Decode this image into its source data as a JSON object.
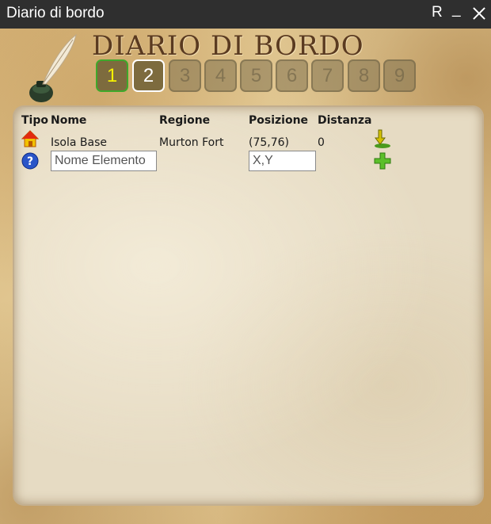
{
  "window": {
    "title": "Diario di bordo",
    "btn_r": "R",
    "btn_min": "_"
  },
  "header": {
    "logo_text": "DIARIO DI BORDO"
  },
  "pages": [
    {
      "label": "1",
      "state": "active"
    },
    {
      "label": "2",
      "state": "current"
    },
    {
      "label": "3",
      "state": "disabled"
    },
    {
      "label": "4",
      "state": "disabled"
    },
    {
      "label": "5",
      "state": "disabled"
    },
    {
      "label": "6",
      "state": "disabled"
    },
    {
      "label": "7",
      "state": "disabled"
    },
    {
      "label": "8",
      "state": "disabled"
    },
    {
      "label": "9",
      "state": "disabled"
    }
  ],
  "table": {
    "columns": {
      "tipo": "Tipo",
      "nome": "Nome",
      "regione": "Regione",
      "posizione": "Posizione",
      "distanza": "Distanza"
    },
    "rows": [
      {
        "type_icon": "house-icon",
        "nome": "Isola Base",
        "regione": "Murton Fort",
        "posizione": "(75,76)",
        "distanza": "0",
        "action_icon": "download-icon"
      }
    ],
    "new_row": {
      "type_icon": "question-icon",
      "name_placeholder": "Nome Elemento",
      "pos_placeholder": "X,Y",
      "action_icon": "plus-icon"
    }
  },
  "colors": {
    "active_page_border": "#3fa82b",
    "active_page_text": "#f6f200",
    "title_text": "#5a3a20"
  }
}
